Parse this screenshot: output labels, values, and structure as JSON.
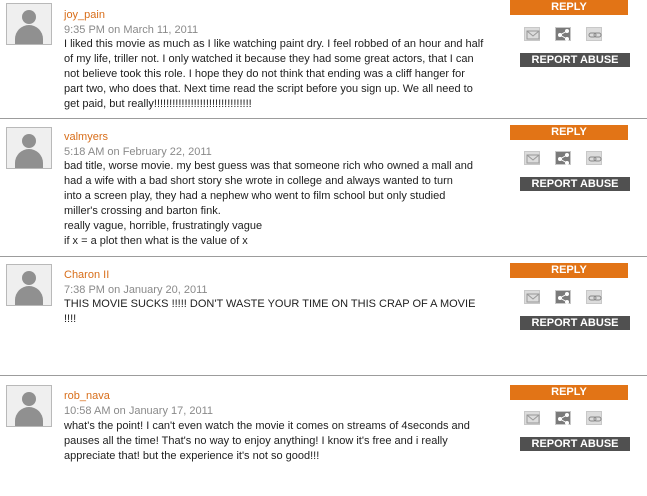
{
  "actions": {
    "reply_label": "REPLY",
    "report_label": "REPORT ABUSE",
    "icons": [
      "email-icon",
      "share-icon",
      "link-icon"
    ]
  },
  "comments": [
    {
      "username": "joy_pain",
      "timestamp": "9:35 PM on March 11, 2011",
      "lines": [
        "I liked this movie as much as I like watching paint dry. I feel robbed of an hour and half",
        "of my life, triller not. I only watched it because they had some great actors, that I can",
        "not believe took this role. I hope they do not think that ending was a cliff hanger for",
        "part two, who does that. Next time read the script before you sign up. We all need to",
        "get paid, but really!!!!!!!!!!!!!!!!!!!!!!!!!!!!!!!!"
      ]
    },
    {
      "username": "valmyers",
      "timestamp": "5:18 AM on February 22, 2011",
      "lines": [
        "bad title, worse movie. my best guess was that someone rich who owned a mall and",
        "had a wife with a bad short story she wrote in college and always wanted to turn",
        "into a screen play, they had a nephew who went to film school but only studied",
        "miller's crossing and barton fink.",
        "really vague, horrible, frustratingly vague",
        "if x = a plot then what is the value of x"
      ]
    },
    {
      "username": "Charon II",
      "timestamp": "7:38 PM on January 20, 2011",
      "lines": [
        "THIS MOVIE SUCKS !!!!! DON'T WASTE YOUR TIME ON THIS CRAP OF A MOVIE !!!!"
      ]
    },
    {
      "username": "rob_nava",
      "timestamp": "10:58 AM on January 17, 2011",
      "lines": [
        "what's the point! I can't even watch the movie it comes on streams of 4seconds and",
        "pauses all the time! That's no way to enjoy anything! I know it's free and i really",
        "appreciate that! but the experience it's not so good!!!"
      ]
    }
  ]
}
